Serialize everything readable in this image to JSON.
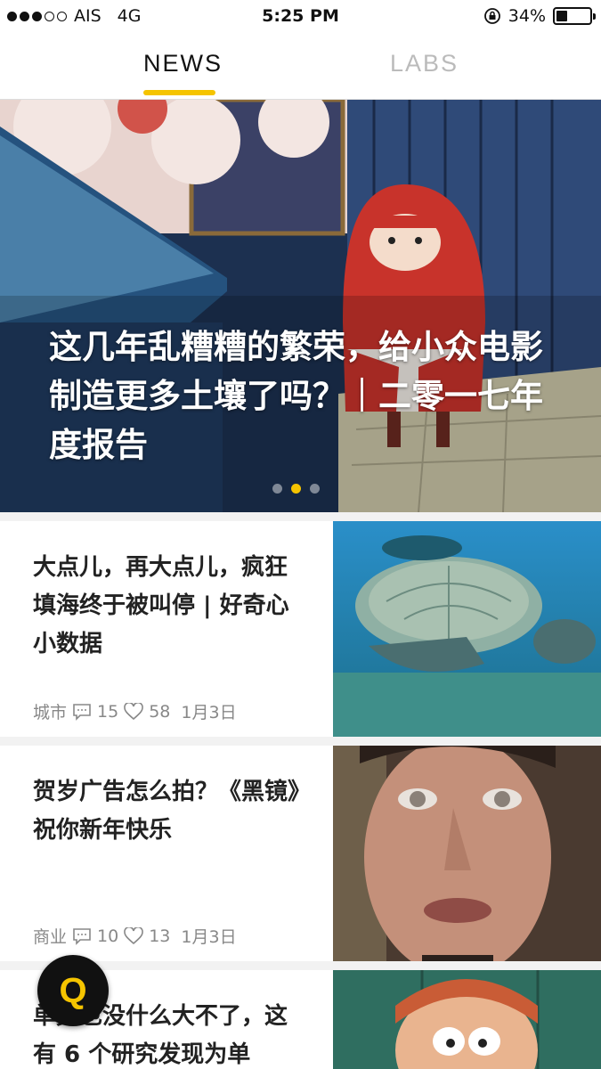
{
  "status_bar": {
    "carrier": "AIS",
    "network": "4G",
    "time": "5:25 PM",
    "battery": "34%",
    "battery_level": 0.34
  },
  "tabs": [
    {
      "label": "NEWS",
      "active": true
    },
    {
      "label": "LABS",
      "active": false
    }
  ],
  "hero": {
    "title": "这几年乱糟糟的繁荣，给小众电影制造更多土壤了吗？｜二零一七年度报告",
    "page_count": 3,
    "active_page": 2
  },
  "articles": [
    {
      "title": "大点儿，再大点儿，疯狂填海终于被叫停 | 好奇心小数据",
      "category": "城市",
      "comments": "15",
      "likes": "58",
      "date": "1月3日",
      "thumb": "sea-turtle"
    },
    {
      "title": "贺岁广告怎么拍？《黑镜》祝你新年快乐",
      "category": "商业",
      "comments": "10",
      "likes": "13",
      "date": "1月3日",
      "thumb": "man-face"
    },
    {
      "title": "单身也没什么大不了，这有 6 个研究发现为单",
      "thumb": "cartoon-character"
    }
  ],
  "fab": {
    "label": "Q"
  },
  "colors": {
    "accent": "#f5c400",
    "tab_inactive": "#bbbbbb",
    "meta": "#888888"
  }
}
